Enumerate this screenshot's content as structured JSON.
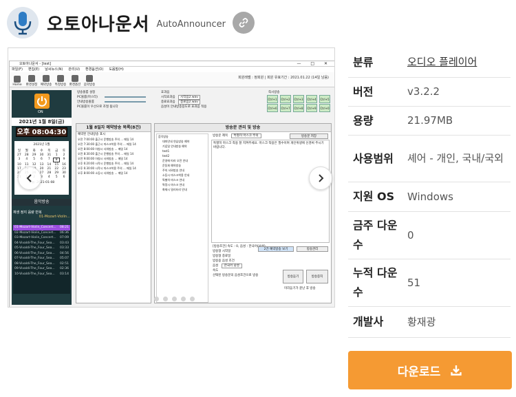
{
  "app": {
    "title": "오토아나운서",
    "subtitle": "AutoAnnouncer"
  },
  "icons": {
    "app": "microphone-icon",
    "share_link": "link-icon",
    "prev": "chevron-left-icon",
    "next": "chevron-right-icon",
    "download": "download-icon"
  },
  "carousel": {
    "slide_count": 5,
    "active_index": 0
  },
  "screenshot": {
    "window_title": "오토아나운서 - [test]",
    "menus": [
      "파일(F)",
      "편집(E)",
      "날씨뉴스(N)",
      "관리(U)",
      "환경옵션(O)",
      "도움말(H)"
    ],
    "toolbar": [
      "Home",
      "환경설정",
      "예약방송",
      "특정방송",
      "환경옵션",
      "음악방송"
    ],
    "top_info": "회원레벨 : 정회원   |   회원 유효기간 : 2021.01.22 (14일 남음)",
    "power_label": "ON",
    "date": "2021년  1월  8일(금)",
    "time": "오후 08:04:30",
    "calendar_title": "2021년 1월",
    "calendar_days": [
      "일",
      "월",
      "화",
      "수",
      "목",
      "금",
      "토"
    ],
    "calendar_dates": [
      "27",
      "28",
      "29",
      "30",
      "31",
      "1",
      "2",
      "3",
      "4",
      "5",
      "6",
      "7",
      "8",
      "9",
      "10",
      "11",
      "12",
      "13",
      "14",
      "15",
      "16",
      "17",
      "18",
      "19",
      "20",
      "21",
      "22",
      "23",
      "24",
      "25",
      "26",
      "27",
      "28",
      "29",
      "30",
      "31",
      "1",
      "2",
      "3",
      "4",
      "5",
      "6"
    ],
    "calendar_today": "오늘: 2021-01-08",
    "music_title": "음악방송",
    "music_controls": "재생   정지   음량   반복",
    "music_now": "01-Mozart-Violin...",
    "playlist": [
      {
        "name": "01-Mozart-Violin_Concert...",
        "time": "08:21"
      },
      {
        "name": "02-Mozart-Violin_Concert...",
        "time": "06:36"
      },
      {
        "name": "03-Mozart-Violin_Concert...",
        "time": "07:09"
      },
      {
        "name": "04-Vivaldi-The_Four_Sea...",
        "time": "03:43"
      },
      {
        "name": "05-Vivaldi-The_Four_Sea...",
        "time": "03:33"
      },
      {
        "name": "06-Vivaldi-The_Four_Sea...",
        "time": "04:56"
      },
      {
        "name": "07-Vivaldi-The_Four_Sea...",
        "time": "05:07"
      },
      {
        "name": "08-Vivaldi-The_Four_Sea...",
        "time": "02:51"
      },
      {
        "name": "09-Vivaldi-The_Four_Sea...",
        "time": "02:36"
      },
      {
        "name": "10-Vivaldi-The_Four_Sea...",
        "time": "03:14"
      }
    ],
    "settings_title1": "방송볼륨 설정",
    "settings_pc": "PC볼륨(마스터)",
    "settings_guide": "안내방송볼륨",
    "settings_note": "PC볼륨이 우선으로 조절 됩니다",
    "chime_title": "효과음",
    "chime_start": "시작효과음",
    "chime_end": "종료효과음",
    "chime_start_file": "시작음2.wav",
    "chime_end_file": "종료음2.wav",
    "chime_note": "음성이 안내방송용도로 효과음 적용",
    "quick_title": "즉시방송",
    "quick_buttons": [
      "Ctrl+1",
      "Ctrl+2",
      "Ctrl+3",
      "Ctrl+4",
      "Ctrl+5",
      "Ctrl+6",
      "Ctrl+7",
      "Ctrl+8",
      "Ctrl+9",
      "Ctrl+0"
    ],
    "reserve_title": "1월 8일자 예약방송 목록(8건)",
    "reserve_check": "예약된 안내방송 표시",
    "reserve_rows": [
      "오전 7:00:00  출근시 운행방송 주의 ...  매일  14",
      "오전 7:30:00  출근시 마스크착용 주의 ...  매일  14",
      "오전 8:00:00  아침시 사워방송 ...  매일  14",
      "오전 8:30:00  출근시 운행방송 주의 ...  매일  14",
      "오전 9:00:00  아침시 사워방송 ...  매일  14",
      "오후 6:20:00  시작시 운행방송 주의 ...  매일  14",
      "오후 6:30:00  시작시 마스크착용 주의 ...  매일  14",
      "오후 8:00:00  소등시 사워방송 ...  매일  14"
    ],
    "tree_items": [
      "음악방송",
      "대피안내 연습방송 예약",
      "기념일 안내방송 예약",
      "test1",
      "test2",
      "운영에 따라 오전 안내",
      "운동회 예약방송",
      "주의 사워방송 안내",
      "소등시 마스크착용 안내",
      "특별히 마스크 안내",
      "특정시 마스크 안내",
      "화재시 밀리터리 안내"
    ],
    "manage_title": "방송문 관리 및 방송",
    "manage_name_label": "방송문 제목",
    "manage_name_value": "특별히 마스크 주의",
    "manage_btn_save": "방송문 저장",
    "manage_btn_search": "검색하기",
    "manage_text": "특별히 마스크 착용 잘 지켜주세요. 마스크 착용은 필수이며 개인위생에 신경써 주시기 바랍니다.",
    "manage_status": "[방송조건] 속도 : 0, 음성 : 한국어(남성)",
    "manage_btn_reserve": "2건 예약방송 보기",
    "manage_btn_special": "방송관리",
    "manage_check1": "방송형 시작일",
    "manage_check2": "방송형 종료일",
    "manage_voice_title": "방송용 음성 조건",
    "manage_voice": "음성",
    "manage_voice_val": "한국어 남성",
    "manage_speed": "속도",
    "manage_btn_play": "방송듣기",
    "manage_btn_stop": "방송중지",
    "manage_bottom": "선택된 방송문의 음성조건으로 방송",
    "manage_bottom2": "미리듣기가 끝난 후 방송"
  },
  "info": {
    "rows": [
      {
        "label": "분류",
        "value": "오디오 플레이어",
        "link": true
      },
      {
        "label": "버전",
        "value": "v3.2.2"
      },
      {
        "label": "용량",
        "value": "21.97MB"
      },
      {
        "label": "사용범위",
        "value": "셰어 - 개인, 국내/국외"
      },
      {
        "label": "지원 OS",
        "value": "Windows"
      },
      {
        "label": "금주 다운수",
        "value": "0"
      },
      {
        "label": "누적 다운수",
        "value": "51"
      },
      {
        "label": "개발사",
        "value": "황재광"
      }
    ]
  },
  "download": {
    "label": "다운로드"
  },
  "colors": {
    "download_bg": "#f59a33",
    "link_btn_bg": "#a8a8a8",
    "app_icon_bg": "#dfe6ee",
    "app_icon_mic": "#2f7cc4",
    "power_btn": "#f39a1e",
    "time_bg": "#3d2016",
    "left_pane_bg": "#1f3b3f",
    "playlist_active": "#9b4fe0"
  }
}
